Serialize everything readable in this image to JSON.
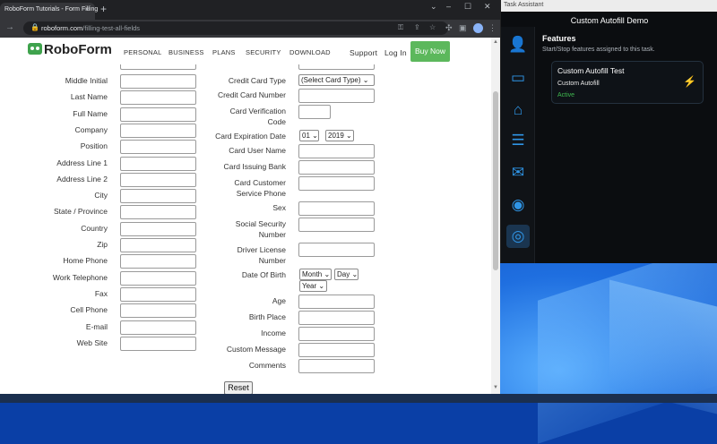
{
  "browser": {
    "tab_title": "RoboForm Tutorials - Form Filling",
    "tab_close": "×",
    "new_tab": "+",
    "url_host": "roboform.com",
    "url_path": "/filling-test-all-fields",
    "window_controls": {
      "collapse": "⌄",
      "minimize": "–",
      "maximize": "☐",
      "close": "✕"
    },
    "icons": {
      "back": "←",
      "forward": "→",
      "reload": "↻",
      "lock": "🔒",
      "key": "⚿",
      "share": "⇪",
      "star": "☆",
      "puzzle": "✣",
      "sidebar": "▣",
      "menu": "⋮"
    }
  },
  "site": {
    "logo_text": "RoboForm",
    "nav": [
      "PERSONAL",
      "BUSINESS",
      "PLANS",
      "SECURITY",
      "DOWNLOAD"
    ],
    "support": "Support",
    "login": "Log In",
    "buy": "Buy Now"
  },
  "form": {
    "left_labels": [
      "Middle Initial",
      "Last Name",
      "Full Name",
      "Company",
      "Position",
      "Address Line 1",
      "Address Line 2",
      "City",
      "State / Province",
      "Country",
      "Zip",
      "Home Phone",
      "Work Telephone",
      "Fax",
      "Cell Phone",
      "E-mail",
      "Web Site"
    ],
    "right_labels": {
      "card_type": "Credit Card Type",
      "card_number": "Credit Card Number",
      "card_verification": [
        "Card Verification",
        "Code"
      ],
      "card_expiration": "Card Expiration Date",
      "card_user": "Card User Name",
      "card_bank": "Card Issuing Bank",
      "card_service": [
        "Card Customer",
        "Service Phone"
      ],
      "sex": "Sex",
      "ssn": [
        "Social Security",
        "Number"
      ],
      "license": [
        "Driver License",
        "Number"
      ],
      "dob": "Date Of Birth",
      "age": "Age",
      "birth_place": "Birth Place",
      "income": "Income",
      "custom_message": "Custom Message",
      "comments": "Comments"
    },
    "selects": {
      "card_type": "(Select Card Type) ⌄",
      "exp_month": "01 ⌄",
      "exp_year": "2019 ⌄",
      "dob_month": "Month ⌄",
      "dob_day": "Day ⌄",
      "dob_year": "Year ⌄"
    },
    "reset": "Reset"
  },
  "assistant": {
    "window_title": "Task Assistant",
    "heading": "Custom Autofill Demo",
    "features_title": "Features",
    "features_sub": "Start/Stop features assigned to this task.",
    "task": {
      "name": "Custom Autofill Test",
      "feature": "Custom Autofill",
      "status": "Active"
    },
    "rail_icons": [
      "👤",
      "▭",
      "⌂",
      "☰",
      "✉",
      "◉",
      "◎"
    ]
  },
  "colors": {
    "accent": "#2f95e6",
    "buy_button": "#5cb85c",
    "status_active": "#3fb950"
  }
}
